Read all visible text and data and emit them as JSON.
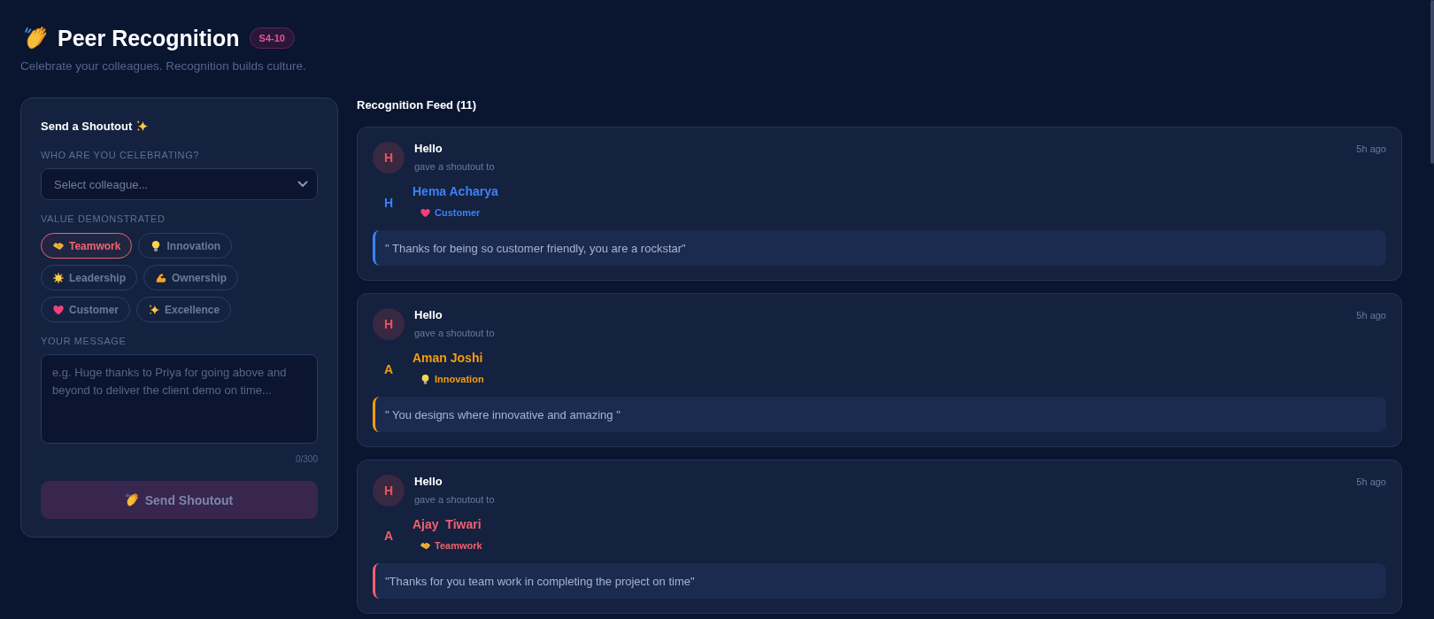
{
  "header": {
    "title": "Peer Recognition",
    "badge": "S4-10",
    "subtitle": "Celebrate your colleagues. Recognition builds culture."
  },
  "shoutout_form": {
    "title": "Send a Shoutout",
    "recipient_label": "WHO ARE YOU CELEBRATING?",
    "recipient_select": {
      "placeholder": "Select colleague..."
    },
    "values_label": "VALUE DEMONSTRATED",
    "values": [
      {
        "label": "Teamwork",
        "selected": true
      },
      {
        "label": "Innovation",
        "selected": false
      },
      {
        "label": "Leadership",
        "selected": false
      },
      {
        "label": "Ownership",
        "selected": false
      },
      {
        "label": "Customer",
        "selected": false
      },
      {
        "label": "Excellence",
        "selected": false
      }
    ],
    "message_label": "YOUR MESSAGE",
    "message": {
      "placeholder": "e.g. Huge thanks to Priya for going above and beyond to deliver the client demo on time..."
    },
    "char_count": "0/300",
    "send_button": {
      "label": "Send Shoutout",
      "disabled": true
    }
  },
  "feed": {
    "title": "Recognition Feed (11)",
    "items": [
      {
        "sender_initial": "H",
        "sender": "Hello",
        "action": "gave a shoutout to",
        "time": "5h ago",
        "recipient_initial": "H",
        "recipient": "Hema Acharya",
        "value": "Customer",
        "color": "#3b82f6",
        "message": "\" Thanks for being so customer friendly, you are a rockstar\""
      },
      {
        "sender_initial": "H",
        "sender": "Hello",
        "action": "gave a shoutout to",
        "time": "5h ago",
        "recipient_initial": "A",
        "recipient": "Aman Joshi",
        "value": "Innovation",
        "color": "#f59e0b",
        "message": "\" You designs where innovative and amazing \""
      },
      {
        "sender_initial": "H",
        "sender": "Hello",
        "action": "gave a shoutout to",
        "time": "5h ago",
        "recipient_initial": "A",
        "recipient": "Ajay  Tiwari",
        "value": "Teamwork",
        "color": "#f0616d",
        "message": "\"Thanks for you team work in completing the project on time\""
      }
    ]
  }
}
